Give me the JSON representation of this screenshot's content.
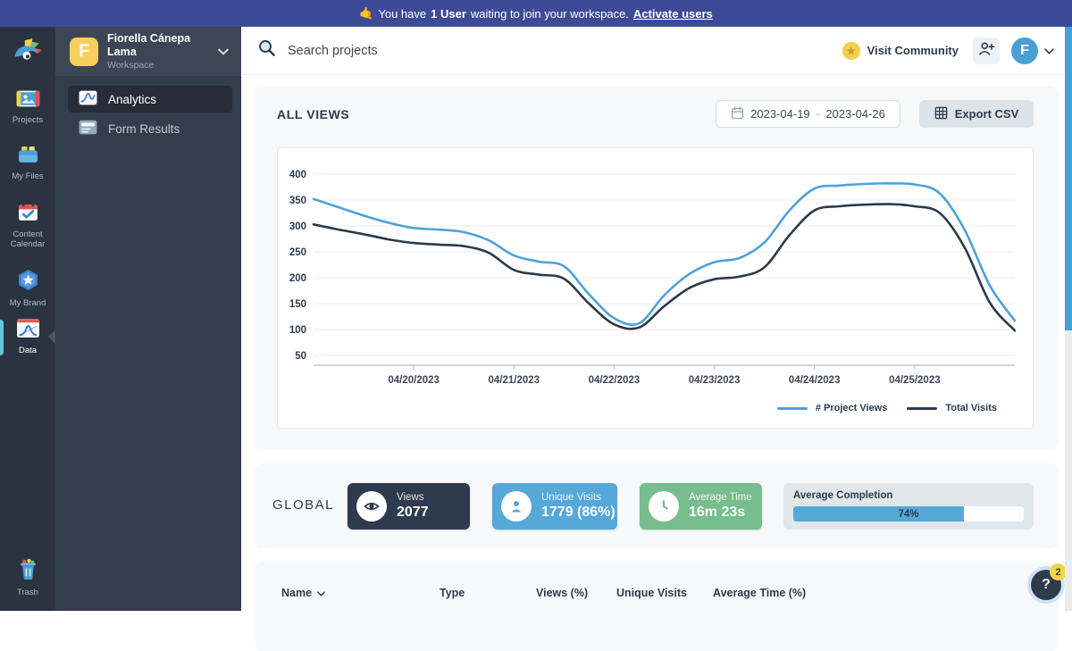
{
  "banner": {
    "emoji": "🤙",
    "text_before": "You have",
    "user_count": "1 User",
    "text_middle": "waiting to join your workspace.",
    "link_label": "Activate users"
  },
  "sidebar": {
    "items": [
      {
        "label": "Projects"
      },
      {
        "label": "My Files"
      },
      {
        "label": "Content Calendar"
      },
      {
        "label": "My Brand"
      },
      {
        "label": "Data"
      }
    ],
    "trash_label": "Trash"
  },
  "workspace": {
    "avatar_letter": "F",
    "name": "Fiorella Cánepa Lama",
    "subtitle": "Workspace",
    "menu": [
      {
        "label": "Analytics"
      },
      {
        "label": "Form Results"
      }
    ]
  },
  "topbar": {
    "search_placeholder": "Search projects",
    "community_label": "Visit Community",
    "avatar_letter": "F"
  },
  "views_panel": {
    "title": "ALL VIEWS",
    "date_from": "2023-04-19",
    "date_separator": "-",
    "date_to": "2023-04-26",
    "export_label": "Export CSV"
  },
  "chart_data": {
    "type": "line",
    "x_domain": [
      0,
      7
    ],
    "x_start_date": "04/19/2023",
    "x_ticks": [
      {
        "x": 1,
        "label": "04/20/2023"
      },
      {
        "x": 2,
        "label": "04/21/2023"
      },
      {
        "x": 3,
        "label": "04/22/2023"
      },
      {
        "x": 4,
        "label": "04/23/2023"
      },
      {
        "x": 5,
        "label": "04/24/2023"
      },
      {
        "x": 6,
        "label": "04/25/2023"
      }
    ],
    "ylim": [
      50,
      400
    ],
    "yticks": [
      50,
      100,
      150,
      200,
      250,
      300,
      350,
      400
    ],
    "grid": "horizontal",
    "legend_position": "bottom-right",
    "series": [
      {
        "name": "# Project Views",
        "color": "#4aa3db",
        "points": [
          [
            0,
            352
          ],
          [
            0.25,
            336
          ],
          [
            0.5,
            320
          ],
          [
            0.75,
            306
          ],
          [
            1,
            296
          ],
          [
            1.25,
            293
          ],
          [
            1.5,
            288
          ],
          [
            1.75,
            272
          ],
          [
            2,
            243
          ],
          [
            2.25,
            231
          ],
          [
            2.5,
            222
          ],
          [
            2.75,
            168
          ],
          [
            3,
            122
          ],
          [
            3.25,
            112
          ],
          [
            3.5,
            166
          ],
          [
            3.75,
            207
          ],
          [
            4,
            230
          ],
          [
            4.25,
            238
          ],
          [
            4.5,
            268
          ],
          [
            4.75,
            330
          ],
          [
            5,
            372
          ],
          [
            5.25,
            378
          ],
          [
            5.5,
            381
          ],
          [
            5.75,
            382
          ],
          [
            6,
            380
          ],
          [
            6.25,
            363
          ],
          [
            6.5,
            292
          ],
          [
            6.75,
            185
          ],
          [
            7,
            117
          ]
        ]
      },
      {
        "name": "Total Visits",
        "color": "#2c3a4d",
        "points": [
          [
            0,
            303
          ],
          [
            0.25,
            293
          ],
          [
            0.5,
            284
          ],
          [
            0.75,
            274
          ],
          [
            1,
            267
          ],
          [
            1.25,
            264
          ],
          [
            1.5,
            261
          ],
          [
            1.75,
            248
          ],
          [
            2,
            215
          ],
          [
            2.25,
            206
          ],
          [
            2.5,
            198
          ],
          [
            2.75,
            150
          ],
          [
            3,
            110
          ],
          [
            3.25,
            104
          ],
          [
            3.5,
            145
          ],
          [
            3.75,
            180
          ],
          [
            4,
            197
          ],
          [
            4.25,
            202
          ],
          [
            4.5,
            220
          ],
          [
            4.75,
            282
          ],
          [
            5,
            330
          ],
          [
            5.25,
            338
          ],
          [
            5.5,
            341
          ],
          [
            5.75,
            342
          ],
          [
            6,
            338
          ],
          [
            6.25,
            325
          ],
          [
            6.5,
            258
          ],
          [
            6.75,
            152
          ],
          [
            7,
            98
          ]
        ]
      }
    ]
  },
  "global_panel": {
    "label": "GLOBAL",
    "stats": [
      {
        "name": "Views",
        "value": "2077",
        "bg": "#2e3a4d"
      },
      {
        "name": "Unique Visits",
        "value": "1779 (86%)",
        "bg": "#55a8d8"
      },
      {
        "name": "Average Time",
        "value": "16m 23s",
        "bg": "#77bd8d"
      }
    ],
    "completion": {
      "label": "Average Completion",
      "percent": 74,
      "display": "74%",
      "bar_color": "#55a8d8"
    }
  },
  "table": {
    "columns": [
      "Name",
      "Type",
      "Views (%)",
      "Unique Visits",
      "Average Time (%)"
    ]
  },
  "help": {
    "icon": "?",
    "badge": "2"
  },
  "scrollbar_color": "#4a9fd8"
}
